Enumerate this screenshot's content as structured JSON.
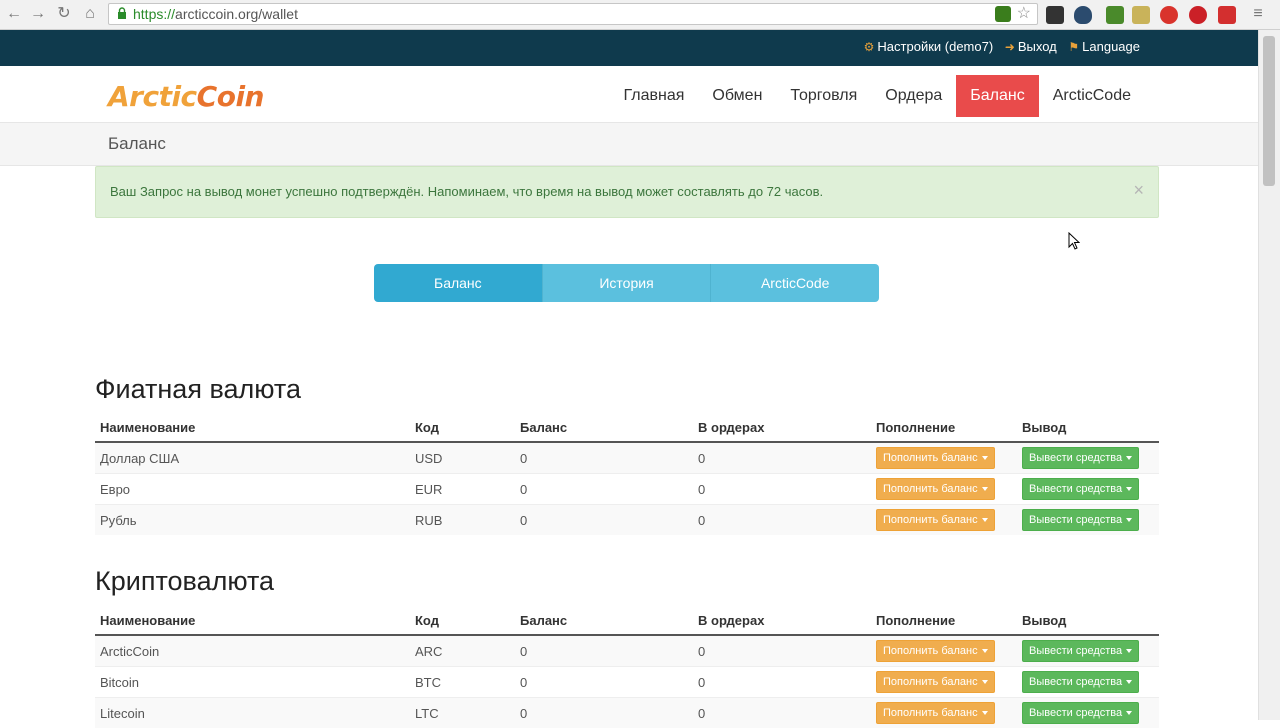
{
  "browser": {
    "url_scheme": "https://",
    "url_rest": "arcticcoin.org/wallet",
    "back_icon": "back-arrow-icon",
    "forward_icon": "forward-arrow-icon",
    "reload_icon": "reload-icon",
    "home_icon": "home-icon",
    "menu_icon": "hamburger-icon"
  },
  "topbar": {
    "settings": "Настройки (demo7)",
    "logout": "Выход",
    "language": "Language"
  },
  "logo": {
    "part1": "Arctic",
    "part2": "Coin"
  },
  "nav": {
    "items": [
      "Главная",
      "Обмен",
      "Торговля",
      "Ордера",
      "Баланс",
      "ArcticCode"
    ],
    "active": "Баланс"
  },
  "breadcrumb": "Баланс",
  "alert": {
    "message": "Ваш Запрос на вывод монет успешно подтверждён. Напоминаем, что время на вывод может составлять до 72 часов.",
    "close": "×"
  },
  "tabs": [
    "Баланс",
    "История",
    "ArcticCode"
  ],
  "columns": {
    "name": "Наименование",
    "code": "Код",
    "balance": "Баланс",
    "orders": "В ордерах",
    "deposit": "Пополнение",
    "withdraw": "Вывод"
  },
  "buttons": {
    "deposit": "Пополнить баланс",
    "withdraw": "Вывести средства"
  },
  "fiat": {
    "title": "Фиатная валюта",
    "rows": [
      {
        "name": "Доллар США",
        "code": "USD",
        "balance": "0",
        "orders": "0"
      },
      {
        "name": "Евро",
        "code": "EUR",
        "balance": "0",
        "orders": "0"
      },
      {
        "name": "Рубль",
        "code": "RUB",
        "balance": "0",
        "orders": "0"
      }
    ]
  },
  "crypto": {
    "title": "Криптовалюта",
    "rows": [
      {
        "name": "ArcticCoin",
        "code": "ARC",
        "balance": "0",
        "orders": "0"
      },
      {
        "name": "Bitcoin",
        "code": "BTC",
        "balance": "0",
        "orders": "0"
      },
      {
        "name": "Litecoin",
        "code": "LTC",
        "balance": "0",
        "orders": "0"
      }
    ]
  },
  "colors": {
    "topbar": "#0f3a4d",
    "active_nav": "#e94b4b",
    "deposit_btn": "#f0ad4e",
    "withdraw_btn": "#5cb85c",
    "tab": "#5bc0de",
    "alert_bg": "#dff0d8"
  }
}
